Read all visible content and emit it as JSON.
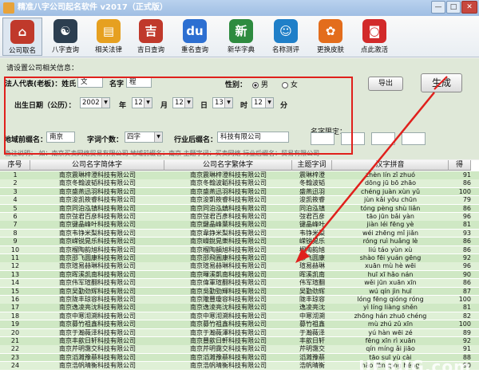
{
  "window": {
    "title": "精准八字公司起名软件 v2017（正式版）",
    "min_label": "—",
    "max_label": "□",
    "close_label": "✕"
  },
  "toolbar": [
    {
      "label": "公司取名",
      "icon": "house-icon",
      "color": "#c0392b",
      "glyph": "⌂"
    },
    {
      "label": "八字查询",
      "icon": "yinyang-icon",
      "color": "#2c3e50",
      "glyph": "☯"
    },
    {
      "label": "相关法律",
      "icon": "book-icon",
      "color": "#e6a020",
      "glyph": "▤"
    },
    {
      "label": "吉日查询",
      "icon": "calendar-icon",
      "color": "#c0392b",
      "glyph": "吉"
    },
    {
      "label": "重名查询",
      "icon": "baidu-paw-icon",
      "color": "#2d6fd1",
      "glyph": "du"
    },
    {
      "label": "新华字典",
      "icon": "dictionary-icon",
      "color": "#2e8b3f",
      "glyph": "新"
    },
    {
      "label": "名称测评",
      "icon": "robot-icon",
      "color": "#1f7fc8",
      "glyph": "☺"
    },
    {
      "label": "更换皮肤",
      "icon": "palette-icon",
      "color": "#e36d1c",
      "glyph": "✿"
    },
    {
      "label": "点此激活",
      "icon": "lock-icon",
      "color": "#d22a2a",
      "glyph": "◙"
    }
  ],
  "form": {
    "section_label": "请设置公司相关信息：",
    "legal_label": "法人代表(老板)：姓氏",
    "surname": "文",
    "given_label": "名字",
    "given": "程",
    "gender_label": "性别：",
    "male": "男",
    "female": "女",
    "birth_label": "出生日期（公历）：",
    "year": "2002",
    "year_unit": "年",
    "month": "12",
    "month_unit": "月",
    "day": "12",
    "day_unit": "日",
    "hour": "13",
    "hour_unit": "时",
    "minute": "12",
    "minute_unit": "分",
    "region_label": "地域前缀名：",
    "region": "南京",
    "wordcount_label": "字词个数：",
    "wordcount": "四字",
    "industry_label": "行业后缀名：",
    "industry": "科技有限公司",
    "limit_label": "名字限定：",
    "note": "备注说明：  如：南京买卖网络贸易有限公司  地域前缀名：南京     主题字词：买卖网络    行业后缀名：贸易有限公司",
    "export_label": "导出",
    "generate_label": "生成"
  },
  "table": {
    "headers": [
      "序号",
      "公司名字简体字",
      "公司名字繁体字",
      "主题字词",
      "汉字拼音",
      "得"
    ],
    "rows": [
      [
        "1",
        "南京震琳梓澄科技有限公司",
        "南京震琳梓澄科技有限公司",
        "震琳梓澄",
        "zhèn lín zǐ zhuó",
        "91"
      ],
      [
        "2",
        "南京冬翰波韬科技有限公司",
        "南京冬翰波韜科技有限公司",
        "冬翰波韬",
        "dōng jū bō zhāo",
        "86"
      ],
      [
        "3",
        "南京盛燕迅羽科技有限公司",
        "南京盛燕迅羽科技有限公司",
        "盛燕迅羽",
        "chéng juàn xùn yǔ",
        "100"
      ],
      [
        "4",
        "南京浚凯筱睿科技有限公司",
        "南京浚凱筱睿科技有限公司",
        "浚凯筱睿",
        "jùn kǎi yǒu chūn",
        "79"
      ],
      [
        "5",
        "南京同泊泓镇科技有限公司",
        "南京同泊泓鎮科技有限公司",
        "同泊泓镇",
        "tóng pèng shù liǎn",
        "86"
      ],
      [
        "6",
        "南京弢君百彦科技有限公司",
        "南京弢君百彥科技有限公司",
        "弢君百彦",
        "tāo jūn bǎi yàn",
        "96"
      ],
      [
        "7",
        "南京键晶峰叶科技有限公司",
        "南京鍵晶峰葉科技有限公司",
        "键晶峰叶",
        "jiàn léi fēng yè",
        "81"
      ],
      [
        "8",
        "南京韦铮米梨科技有限公司",
        "南京韋錚米梨科技有限公司",
        "韦铮米梨",
        "wéi zhēng mǐ jiǎn",
        "93"
      ],
      [
        "9",
        "南京嵘锐晃乐科技有限公司",
        "南京嶸銳晃樂科技有限公司",
        "嵘锐晃乐",
        "róng ruì huǎng lè",
        "86"
      ],
      [
        "10",
        "南京榴陶韵旭科技有限公司",
        "南京榴陶韻旭科技有限公司",
        "榴陶韵旭",
        "liú táo yùn xù",
        "86"
      ],
      [
        "11",
        "南京邵飞圆康科技有限公司",
        "南京邵飛圓康科技有限公司",
        "邵飞圆康",
        "shào fēi yuán gēng",
        "92"
      ],
      [
        "12",
        "南京瑄易赫琳科技有限公司",
        "南京瑄易赫琳科技有限公司",
        "瑄易赫琳",
        "xuān mù hè wēi",
        "96"
      ],
      [
        "13",
        "南京晖溪凯南科技有限公司",
        "南京暉溪凱南科技有限公司",
        "晖溪凯南",
        "huī xī hǎo nán",
        "90"
      ],
      [
        "14",
        "南京伟军瑄翻科技有限公司",
        "南京偉軍瑄翻科技有限公司",
        "伟军瑄翻",
        "wěi jūn xuān xīn",
        "86"
      ],
      [
        "15",
        "南京吴勤劲辉科技有限公司",
        "南京吳勤勁輝科技有限公司",
        "吴勤劲辉",
        "wú qín jìn huī",
        "87"
      ],
      [
        "16",
        "南京陇丰琼容科技有限公司",
        "南京隴豐瓊容科技有限公司",
        "陇丰琼容",
        "lóng fēng qióng róng",
        "100"
      ],
      [
        "17",
        "南京逸凌亮沈科技有限公司",
        "南京逸淩亮沈科技有限公司",
        "逸凌亮沈",
        "yì líng liàng shěn",
        "81"
      ],
      [
        "18",
        "南京中寒沏溯科技有限公司",
        "南京中寒沏溯科技有限公司",
        "中寒沏溯",
        "zhōng hán zhuō chéng",
        "82"
      ],
      [
        "19",
        "南京募竹祖鑫科技有限公司",
        "南京募竹祖鑫科技有限公司",
        "募竹祖鑫",
        "mù zhú zǔ xīn",
        "100"
      ],
      [
        "20",
        "南京于瀚薇泽科技有限公司",
        "南京于瀚薇澤科技有限公司",
        "于瀚薇泽",
        "yú hàn wēi zé",
        "89"
      ],
      [
        "21",
        "南京丰歆日轩科技有限公司",
        "南京豐歆日軒科技有限公司",
        "丰歆日轩",
        "fēng xīn rì xuān",
        "92"
      ],
      [
        "22",
        "南京芹明霭交科技有限公司",
        "南京芹明靄交科技有限公司",
        "芹明霭交",
        "qín míng ǎi jiāo",
        "91"
      ],
      [
        "23",
        "南京滔濉豫蔡科技有限公司",
        "南京滔濉豫蔡科技有限公司",
        "滔濉豫蔡",
        "tāo suī yù cài",
        "88"
      ],
      [
        "24",
        "南京浩帆晴衡科技有限公司",
        "南京浩帆晴衡科技有限公司",
        "浩帆晴衡",
        "hào fān qíng héng",
        "90"
      ]
    ]
  },
  "watermark": "UEBUG.com",
  "accent": "#e0201c"
}
